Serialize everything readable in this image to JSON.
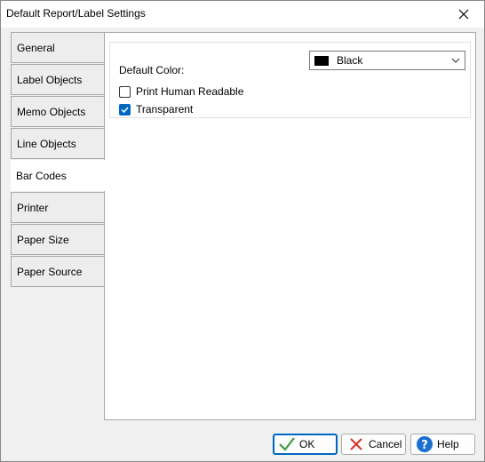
{
  "window": {
    "title": "Default Report/Label Settings"
  },
  "tabs": [
    {
      "label": "General",
      "active": false
    },
    {
      "label": "Label Objects",
      "active": false
    },
    {
      "label": "Memo Objects",
      "active": false
    },
    {
      "label": "Line Objects",
      "active": false
    },
    {
      "label": "Bar Codes",
      "active": true
    },
    {
      "label": "Printer",
      "active": false
    },
    {
      "label": "Paper Size",
      "active": false
    },
    {
      "label": "Paper Source",
      "active": false
    }
  ],
  "settings": {
    "default_color_label": "Default Color:",
    "default_color_value": "Black",
    "default_color_swatch": "#000000",
    "print_human_readable_label": "Print Human Readable",
    "print_human_readable_checked": false,
    "transparent_label": "Transparent",
    "transparent_checked": true
  },
  "buttons": {
    "ok": "OK",
    "cancel": "Cancel",
    "help": "Help"
  },
  "colors": {
    "accent": "#0067c0",
    "cancel_red": "#d93025",
    "ok_green": "#3c9b3c"
  }
}
